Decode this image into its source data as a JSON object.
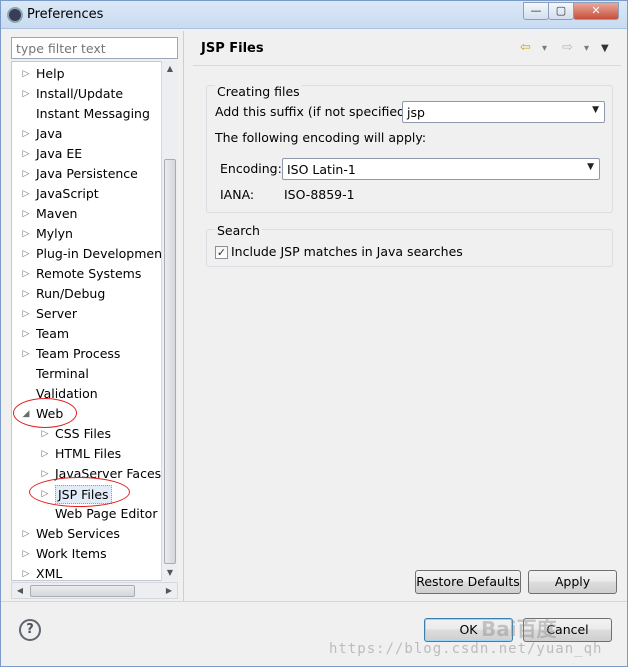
{
  "window": {
    "title": "Preferences",
    "min_glyph": "—",
    "max_glyph": "▢",
    "close_glyph": "✕"
  },
  "filter": {
    "placeholder": "type filter text"
  },
  "tree": [
    {
      "label": "Help",
      "arrow": "▷",
      "depth": 0
    },
    {
      "label": "Install/Update",
      "arrow": "▷",
      "depth": 0
    },
    {
      "label": "Instant Messaging",
      "arrow": "",
      "depth": 0
    },
    {
      "label": "Java",
      "arrow": "▷",
      "depth": 0
    },
    {
      "label": "Java EE",
      "arrow": "▷",
      "depth": 0
    },
    {
      "label": "Java Persistence",
      "arrow": "▷",
      "depth": 0
    },
    {
      "label": "JavaScript",
      "arrow": "▷",
      "depth": 0
    },
    {
      "label": "Maven",
      "arrow": "▷",
      "depth": 0
    },
    {
      "label": "Mylyn",
      "arrow": "▷",
      "depth": 0
    },
    {
      "label": "Plug-in Development",
      "arrow": "▷",
      "depth": 0
    },
    {
      "label": "Remote Systems",
      "arrow": "▷",
      "depth": 0
    },
    {
      "label": "Run/Debug",
      "arrow": "▷",
      "depth": 0
    },
    {
      "label": "Server",
      "arrow": "▷",
      "depth": 0
    },
    {
      "label": "Team",
      "arrow": "▷",
      "depth": 0
    },
    {
      "label": "Team Process",
      "arrow": "▷",
      "depth": 0
    },
    {
      "label": "Terminal",
      "arrow": "",
      "depth": 0
    },
    {
      "label": "Validation",
      "arrow": "",
      "depth": 0
    },
    {
      "label": "Web",
      "arrow": "◢",
      "depth": 0
    },
    {
      "label": "CSS Files",
      "arrow": "▷",
      "depth": 1
    },
    {
      "label": "HTML Files",
      "arrow": "▷",
      "depth": 1
    },
    {
      "label": "JavaServer Faces T",
      "arrow": "▷",
      "depth": 1
    },
    {
      "label": "JSP Files",
      "arrow": "▷",
      "depth": 1,
      "selected": true
    },
    {
      "label": "Web Page Editor",
      "arrow": "",
      "depth": 1
    },
    {
      "label": "Web Services",
      "arrow": "▷",
      "depth": 0
    },
    {
      "label": "Work Items",
      "arrow": "▷",
      "depth": 0
    },
    {
      "label": "XML",
      "arrow": "▷",
      "depth": 0
    }
  ],
  "page": {
    "title": "JSP Files",
    "nav_back_icon": "⇦",
    "nav_forward_icon": "⇨",
    "dropdown_glyph": "▾",
    "menu_glyph": "▼"
  },
  "creating": {
    "group_title": "Creating files",
    "suffix_label": "Add this suffix (if not specified):",
    "suffix_value": "jsp",
    "encoding_note": "The following encoding will apply:",
    "encoding_label": "Encoding:",
    "encoding_value": "ISO Latin-1",
    "iana_label": "IANA:",
    "iana_value": "ISO-8859-1"
  },
  "search": {
    "group_title": "Search",
    "checkbox_label": "Include JSP matches in Java searches",
    "checked": true,
    "check_glyph": "✓"
  },
  "buttons": {
    "restore_defaults": "Restore Defaults",
    "apply": "Apply",
    "ok": "OK",
    "cancel": "Cancel",
    "help_glyph": "?"
  },
  "watermark": {
    "url": "https://blog.csdn.net/yuan_qh",
    "logo": "Bai百度"
  },
  "colors": {
    "accent": "#3c7fb1",
    "annotation": "#e02020"
  }
}
